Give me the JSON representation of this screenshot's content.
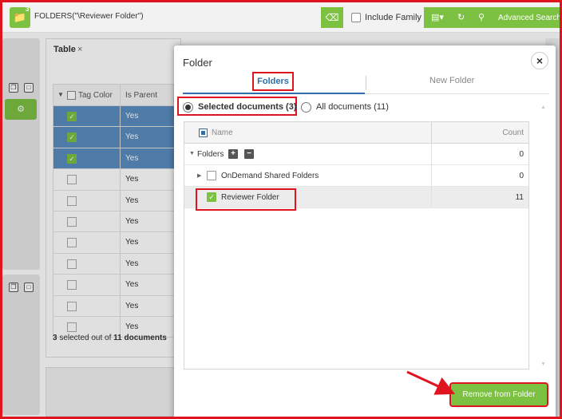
{
  "topbar": {
    "folder_badge": "3",
    "query": "FOLDERS(\"\\Reviewer Folder\")",
    "include_family_label": "Include Family",
    "advanced_search_label": "Advanced Search"
  },
  "table_panel": {
    "title": "Table",
    "columns": [
      "Tag Color",
      "Is Parent"
    ],
    "rows": [
      {
        "checked": true,
        "selected": true,
        "is_parent": "Yes"
      },
      {
        "checked": true,
        "selected": true,
        "is_parent": "Yes"
      },
      {
        "checked": true,
        "selected": true,
        "is_parent": "Yes"
      },
      {
        "checked": false,
        "selected": false,
        "is_parent": "Yes"
      },
      {
        "checked": false,
        "selected": false,
        "is_parent": "Yes"
      },
      {
        "checked": false,
        "selected": false,
        "is_parent": "Yes"
      },
      {
        "checked": false,
        "selected": false,
        "is_parent": "Yes"
      },
      {
        "checked": false,
        "selected": false,
        "is_parent": "Yes"
      },
      {
        "checked": false,
        "selected": false,
        "is_parent": "Yes"
      },
      {
        "checked": false,
        "selected": false,
        "is_parent": "Yes"
      },
      {
        "checked": false,
        "selected": false,
        "is_parent": "Yes"
      }
    ],
    "summary_selected": "3",
    "summary_mid": " selected out of ",
    "summary_total": "11 documents"
  },
  "modal": {
    "title": "Folder",
    "tabs": [
      {
        "label": "Folders",
        "active": true
      },
      {
        "label": "New Folder",
        "active": false
      }
    ],
    "scope_options": [
      {
        "label": "Selected documents (3)",
        "selected": true
      },
      {
        "label": "All documents (11)",
        "selected": false
      }
    ],
    "tree": {
      "columns": {
        "name": "Name",
        "count": "Count"
      },
      "rows": [
        {
          "label": "Folders",
          "count": "0",
          "checked": false
        },
        {
          "label": "OnDemand Shared Folders",
          "count": "0",
          "checked": false
        },
        {
          "label": "Reviewer Folder",
          "count": "11",
          "checked": true
        }
      ]
    },
    "action_button": "Remove from Folder"
  },
  "colors": {
    "accent_green": "#7cc142",
    "highlight_red": "#e0141e",
    "link_blue": "#2f6ea8",
    "selection_blue": "#5b8cc0"
  }
}
